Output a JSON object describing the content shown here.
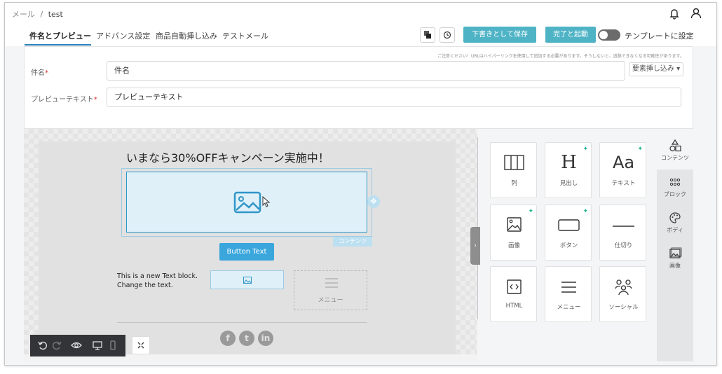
{
  "breadcrumb": {
    "root": "メール",
    "separator": "/",
    "current": "test"
  },
  "tabs": [
    {
      "label": "件名とプレビュー"
    },
    {
      "label": "アドバンス設定"
    },
    {
      "label": "商品自動挿し込み"
    },
    {
      "label": "テストメール"
    }
  ],
  "toolbar": {
    "save_draft_label": "下書きとして保存",
    "complete_label": "完了と起動",
    "template_toggle_label": "テンプレートに設定"
  },
  "form": {
    "notice": "ご注意ください！URLはハイパーリンクを使用して追加する必要があります。そうしないと、追跡できなくなる可能性があります。",
    "subject_label": "件名",
    "subject_value": "件名",
    "insert_label": "要素挿し込み",
    "preview_label": "プレビューテキスト",
    "preview_value": "プレビューテキスト",
    "required_mark": "*"
  },
  "email": {
    "headline": "いまなら30%OFFキャンペーン実施中！",
    "content_tag": "コンテンツ",
    "button_text": "Button Text",
    "text_block": "This is a new Text block. Change the text.",
    "menu_label": "メニュー",
    "social": [
      "f",
      "t",
      "in"
    ]
  },
  "panel": {
    "cards": [
      {
        "label": "列",
        "icon": "columns-icon",
        "new": false
      },
      {
        "label": "見出し",
        "icon": "heading-icon",
        "new": true
      },
      {
        "label": "テキスト",
        "icon": "text-icon",
        "new": true
      },
      {
        "label": "画像",
        "icon": "image-icon",
        "new": true
      },
      {
        "label": "ボタン",
        "icon": "button-icon",
        "new": true
      },
      {
        "label": "仕切り",
        "icon": "divider-icon",
        "new": false
      },
      {
        "label": "HTML",
        "icon": "html-icon",
        "new": false
      },
      {
        "label": "メニュー",
        "icon": "menu-icon",
        "new": false
      },
      {
        "label": "ソーシャル",
        "icon": "social-icon",
        "new": false
      }
    ],
    "heading_glyph": "H",
    "text_glyph": "Aa"
  },
  "sidebar": [
    {
      "label": "コンテンツ",
      "icon": "shapes-icon"
    },
    {
      "label": "ブロック",
      "icon": "blocks-icon"
    },
    {
      "label": "ボディ",
      "icon": "palette-icon"
    },
    {
      "label": "画像",
      "icon": "images-icon"
    }
  ],
  "colors": {
    "accent": "#4fb3c6",
    "selection": "#2f96c8",
    "button": "#3aa6dc",
    "new_badge": "#1fb48f"
  }
}
